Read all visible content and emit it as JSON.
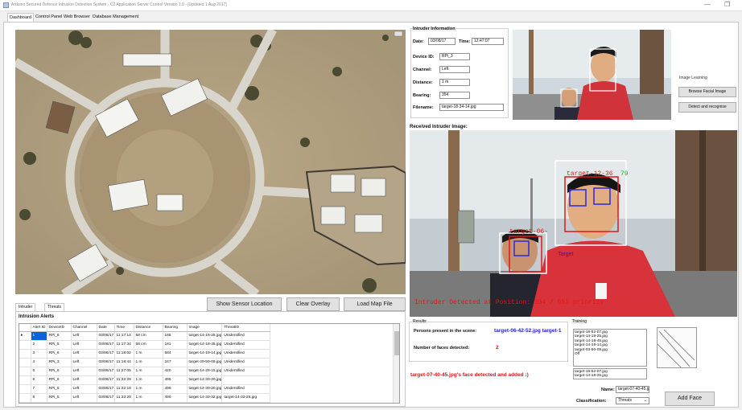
{
  "window": {
    "title": "Arduino Secured Defence Intrusion Detection System - C2 Application Server Control Version 1.0 - [Updated 1 Aug 2017]",
    "minimize": "—",
    "restore": "❐"
  },
  "menu_tabs": [
    "Dashboard",
    "Control Panel",
    "Web Browser",
    "Database Management"
  ],
  "map_buttons": {
    "show_sensor": "Show Sensor Location",
    "clear_overlay": "Clear Overlay",
    "load_map": "Load Map File"
  },
  "bottom_tabs": [
    "Intruder Alerts",
    "Threats"
  ],
  "alerts": {
    "title": "Intrusion Alerts",
    "columns": [
      "Alert ID",
      "DeviceID",
      "Channel",
      "Date",
      "Time",
      "Distance",
      "Bearing",
      "Image",
      "ThreatID"
    ],
    "rows": [
      [
        "1",
        "RPi_6",
        "Left",
        "03/08/17",
        "11:17:14",
        "58 cm",
        "185",
        "target-14-18-25.jpg",
        "Unidentified"
      ],
      [
        "2",
        "RPi_5",
        "Left",
        "03/08/17",
        "11:17:34",
        "58 cm",
        "181",
        "target-14-18-45.jpg",
        "Unidentified"
      ],
      [
        "3",
        "RPi_6",
        "Left",
        "03/08/17",
        "11:18:02",
        "1 m",
        "584",
        "target-14-19-14.jpg",
        "Unidentified"
      ],
      [
        "4",
        "RPi_3",
        "Left",
        "03/08/17",
        "11:18:44",
        "1 m",
        "247",
        "target-29-50-09.jpg",
        "Unidentified"
      ],
      [
        "5",
        "RPi_6",
        "Left",
        "03/08/17",
        "11:27:05",
        "1 m",
        "420",
        "target-14-28-15.jpg",
        "Unidentified"
      ],
      [
        "6",
        "RPi_6",
        "Left",
        "03/08/17",
        "11:32:29",
        "1 m",
        "496",
        "target-14-30-20.jpg",
        ""
      ],
      [
        "7",
        "RPi_6",
        "Left",
        "03/08/17",
        "11:32:18",
        "1 m",
        "496",
        "target-14-30-20.jpg",
        "Unidentified"
      ],
      [
        "8",
        "RPi_5",
        "Left",
        "03/08/17",
        "11:33:20",
        "1 m",
        "490",
        "target-14-33-32.jpg",
        "target-14-33-26.jpg"
      ]
    ]
  },
  "intruder_info": {
    "title": "Intruder Information",
    "date_label": "Date:",
    "date_value": "03/08/17",
    "time_label": "Time:",
    "time_value": "12:47:07",
    "device_label": "Device ID:",
    "device_value": "RPi_3",
    "channel_label": "Channel:",
    "channel_value": "Left",
    "distance_label": "Distance:",
    "distance_value": "1 m",
    "bearing_label": "Bearing:",
    "bearing_value": "354",
    "filename_label": "Filename:",
    "filename_value": "target-18-34-14.jpg"
  },
  "image_learning": {
    "title": "Image Learning",
    "browse_button": "Browse Facial Image",
    "detect_button": "Detect and recognise"
  },
  "received_title": "Received Intruder Image:",
  "overlay": {
    "target_label_big": "target-12-36",
    "target_label_big_conf": "79",
    "target_label_small": "target-06-",
    "target_label_small_conf": "...",
    "target_tag": "Target",
    "bottom_text": "Intruder Detected at Position: 354 / 053 priority"
  },
  "results": {
    "title": "Results",
    "persons_label": "Persons present in the scene:",
    "persons_value": "target-06-42-52.jpg target-1",
    "faces_label": "Number of faces detected:",
    "faces_value": "2",
    "status_message": "target-07-40-45.jpg's face detected and added :)"
  },
  "training": {
    "title": "Training",
    "list_top": [
      "target-18-52-07.jpg",
      "target-14-18-25.jpg",
      "target-14-18-45.jpg",
      "target-14-19-14.jpg",
      "target-03-50-09.jpg",
      "Off"
    ],
    "list_bottom": [
      "target-18-52-07.jpg",
      "target-14-18-25.jpg"
    ],
    "name_label": "Name:",
    "name_value": "target-07-40-45.jpg",
    "class_label": "Classification:",
    "class_value": "Threats",
    "add_face_button": "Add Face"
  }
}
